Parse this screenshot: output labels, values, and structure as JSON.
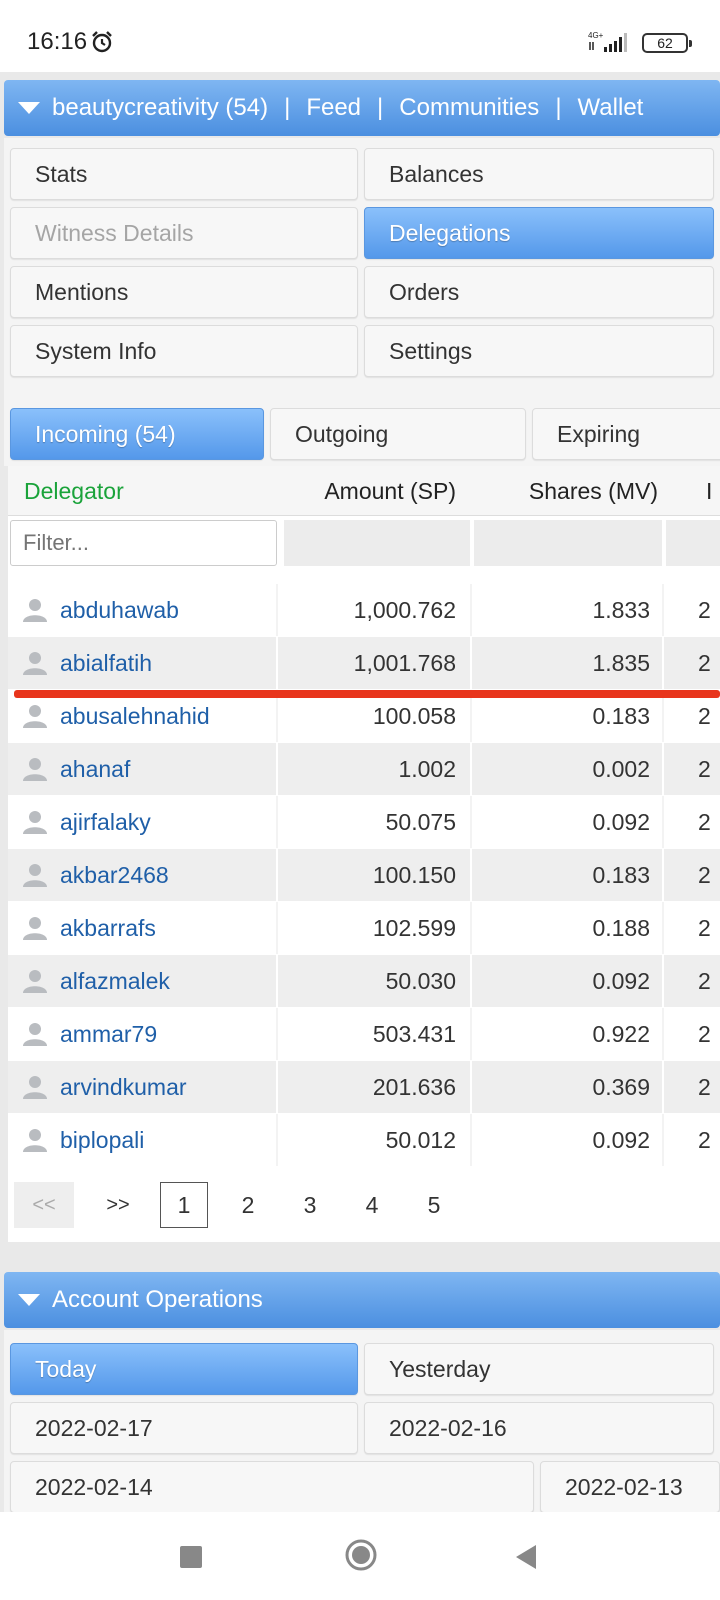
{
  "status_bar": {
    "time": "16:16",
    "network": "4G+",
    "battery": "62"
  },
  "header": {
    "account": "beautycreativity (54)",
    "feed": "Feed",
    "communities": "Communities",
    "wallet": "Wallet",
    "separator": "|"
  },
  "menu": {
    "stats": "Stats",
    "balances": "Balances",
    "witness_details": "Witness Details",
    "delegations": "Delegations",
    "mentions": "Mentions",
    "orders": "Orders",
    "system_info": "System Info",
    "settings": "Settings"
  },
  "delegation_tabs": {
    "incoming": "Incoming (54)",
    "outgoing": "Outgoing",
    "expiring": "Expiring"
  },
  "table": {
    "headers": {
      "delegator": "Delegator",
      "amount": "Amount (SP)",
      "shares": "Shares (MV)",
      "cut": "I"
    },
    "filter_placeholder": "Filter...",
    "rows": [
      {
        "delegator": "abduhawab",
        "amount": "1,000.762",
        "shares": "1.833",
        "cut": "2"
      },
      {
        "delegator": "abialfatih",
        "amount": "1,001.768",
        "shares": "1.835",
        "cut": "2"
      },
      {
        "delegator": "abusalehnahid",
        "amount": "100.058",
        "shares": "0.183",
        "cut": "2"
      },
      {
        "delegator": "ahanaf",
        "amount": "1.002",
        "shares": "0.002",
        "cut": "2"
      },
      {
        "delegator": "ajirfalaky",
        "amount": "50.075",
        "shares": "0.092",
        "cut": "2"
      },
      {
        "delegator": "akbar2468",
        "amount": "100.150",
        "shares": "0.183",
        "cut": "2"
      },
      {
        "delegator": "akbarrafs",
        "amount": "102.599",
        "shares": "0.188",
        "cut": "2"
      },
      {
        "delegator": "alfazmalek",
        "amount": "50.030",
        "shares": "0.092",
        "cut": "2"
      },
      {
        "delegator": "ammar79",
        "amount": "503.431",
        "shares": "0.922",
        "cut": "2"
      },
      {
        "delegator": "arvindkumar",
        "amount": "201.636",
        "shares": "0.369",
        "cut": "2"
      },
      {
        "delegator": "biplopali",
        "amount": "50.012",
        "shares": "0.092",
        "cut": "2"
      }
    ]
  },
  "pagination": {
    "prev": "<<",
    "next": ">>",
    "pages": [
      "1",
      "2",
      "3",
      "4",
      "5"
    ],
    "current": "1"
  },
  "account_operations": {
    "title": "Account Operations",
    "today": "Today",
    "yesterday": "Yesterday",
    "dates": [
      "2022-02-17",
      "2022-02-16",
      "2022-02-14",
      "2022-02-13"
    ]
  },
  "colors": {
    "accent_blue": "#4b8fe0",
    "link_blue": "#1f5fa8",
    "delegator_header_green": "#1aa33a",
    "highlight_red": "#e8351c"
  }
}
